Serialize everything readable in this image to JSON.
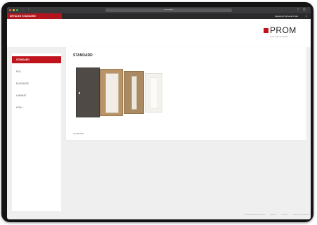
{
  "browser": {
    "url": "prom.example",
    "nav": {
      "back": "‹",
      "forward": "›",
      "share": "⇪",
      "tabs": "⧉"
    },
    "dot_colors": [
      "#ff5f57",
      "#febc2e",
      "#28c840"
    ]
  },
  "app_bar": {
    "title": "DETALES STANDARD",
    "account": "Realaria Proizvoda Prakt",
    "close": "×"
  },
  "logo": {
    "word": "PROM",
    "tagline": "Prom Vrata Armaturaa"
  },
  "sidebar": {
    "items": [
      {
        "label": "STANDARD",
        "active": true
      },
      {
        "label": "PVC"
      },
      {
        "label": "ELEGANTE"
      },
      {
        "label": "LAMINAT"
      },
      {
        "label": "KONJ"
      }
    ]
  },
  "content": {
    "title": "STANDARD",
    "caption": "STANDARD",
    "doors": [
      {
        "name": "door-dark-walnut",
        "color": "#4f4a45"
      },
      {
        "name": "door-oak-glass",
        "color": "#b89468"
      },
      {
        "name": "door-oak-slim-glass",
        "color": "#a98a62"
      },
      {
        "name": "door-white-glass",
        "color": "#f4f2ec"
      }
    ]
  },
  "footer": {
    "links": [
      "© 2024 PROM Proizvodna Vrata",
      "Uslovi kori",
      "Privatnost",
      "Kontakt i Pomoć Sistema"
    ]
  },
  "colors": {
    "accent": "#c0141c",
    "device": "#141414",
    "background": "#efefef"
  }
}
